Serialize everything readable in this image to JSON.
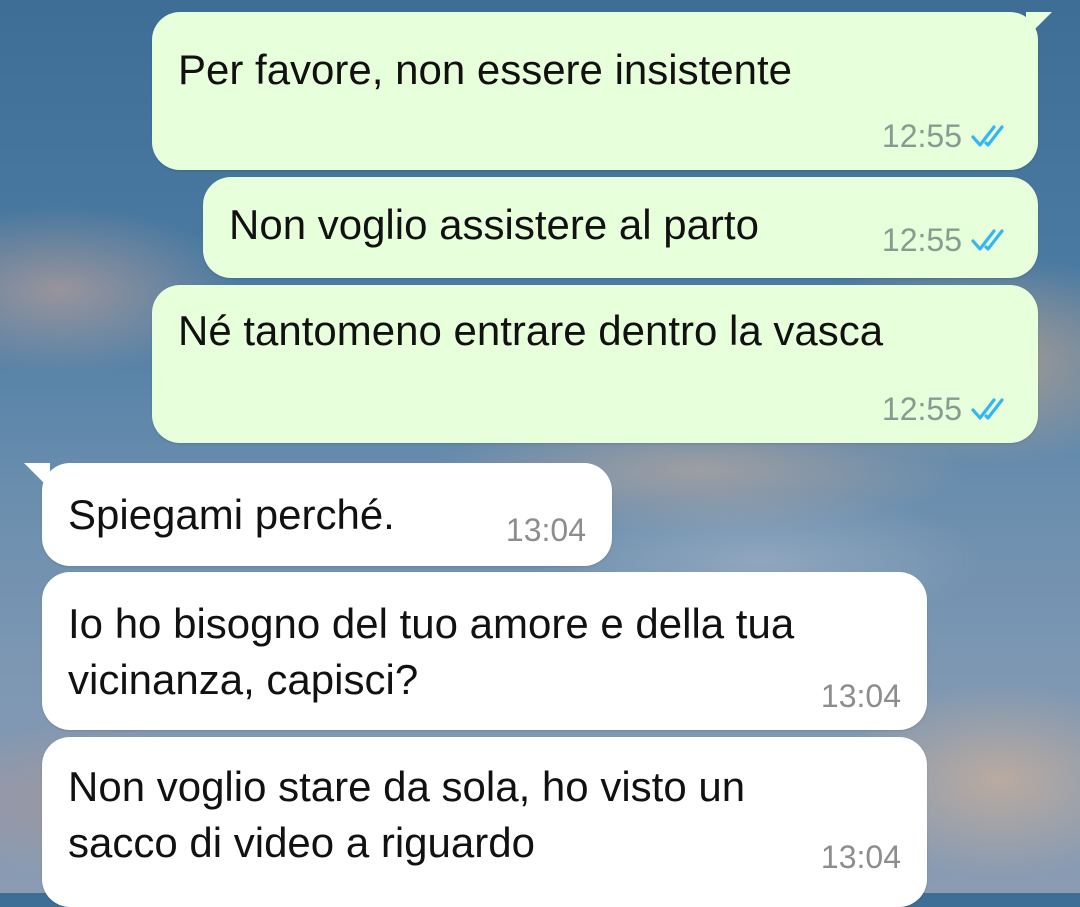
{
  "messages": [
    {
      "direction": "outgoing",
      "text": "Per favore, non essere insistente",
      "time": "12:55",
      "status": "read"
    },
    {
      "direction": "outgoing",
      "text": "Non voglio assistere al parto",
      "time": "12:55",
      "status": "read"
    },
    {
      "direction": "outgoing",
      "text": "Né tantomeno entrare dentro la vasca",
      "time": "12:55",
      "status": "read"
    },
    {
      "direction": "incoming",
      "text": "Spiegami perché.",
      "time": "13:04"
    },
    {
      "direction": "incoming",
      "text": "Io ho bisogno del tuo amore e della tua\nvicinanza, capisci?",
      "time": "13:04"
    },
    {
      "direction": "incoming",
      "text": "Non voglio stare da sola, ho visto un\nsacco di video a riguardo",
      "time": "13:04"
    }
  ],
  "colors": {
    "outgoing_bubble": "#e7ffdb",
    "incoming_bubble": "#ffffff",
    "read_tick": "#34b7f1"
  },
  "icons": {
    "read_status": "double-check-icon"
  }
}
